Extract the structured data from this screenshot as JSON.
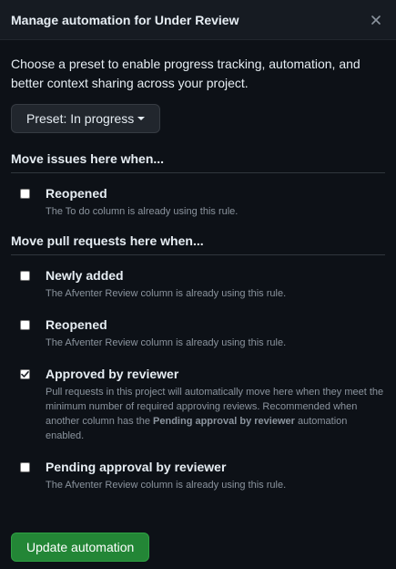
{
  "dialog": {
    "title": "Manage automation for Under Review",
    "intro": "Choose a preset to enable progress tracking, automation, and better context sharing across your project.",
    "preset_label": "Preset: In progress",
    "update_label": "Update automation"
  },
  "issues_section": {
    "title": "Move issues here when...",
    "options": [
      {
        "label": "Reopened",
        "checked": false,
        "desc": "The To do column is already using this rule."
      }
    ]
  },
  "prs_section": {
    "title": "Move pull requests here when...",
    "options": [
      {
        "label": "Newly added",
        "checked": false,
        "desc": "The Afventer Review column is already using this rule."
      },
      {
        "label": "Reopened",
        "checked": false,
        "desc": "The Afventer Review column is already using this rule."
      },
      {
        "label": "Approved by reviewer",
        "checked": true,
        "desc_pre": "Pull requests in this project will automatically move here when they meet the minimum number of required approving reviews. Recommended when another column has the ",
        "desc_bold": "Pending approval by reviewer",
        "desc_post": " automation enabled."
      },
      {
        "label": "Pending approval by reviewer",
        "checked": false,
        "desc": "The Afventer Review column is already using this rule."
      }
    ]
  },
  "colors": {
    "background": "#0d1117",
    "header": "#161b22",
    "primary_button": "#238636",
    "muted_text": "#8b949e"
  }
}
